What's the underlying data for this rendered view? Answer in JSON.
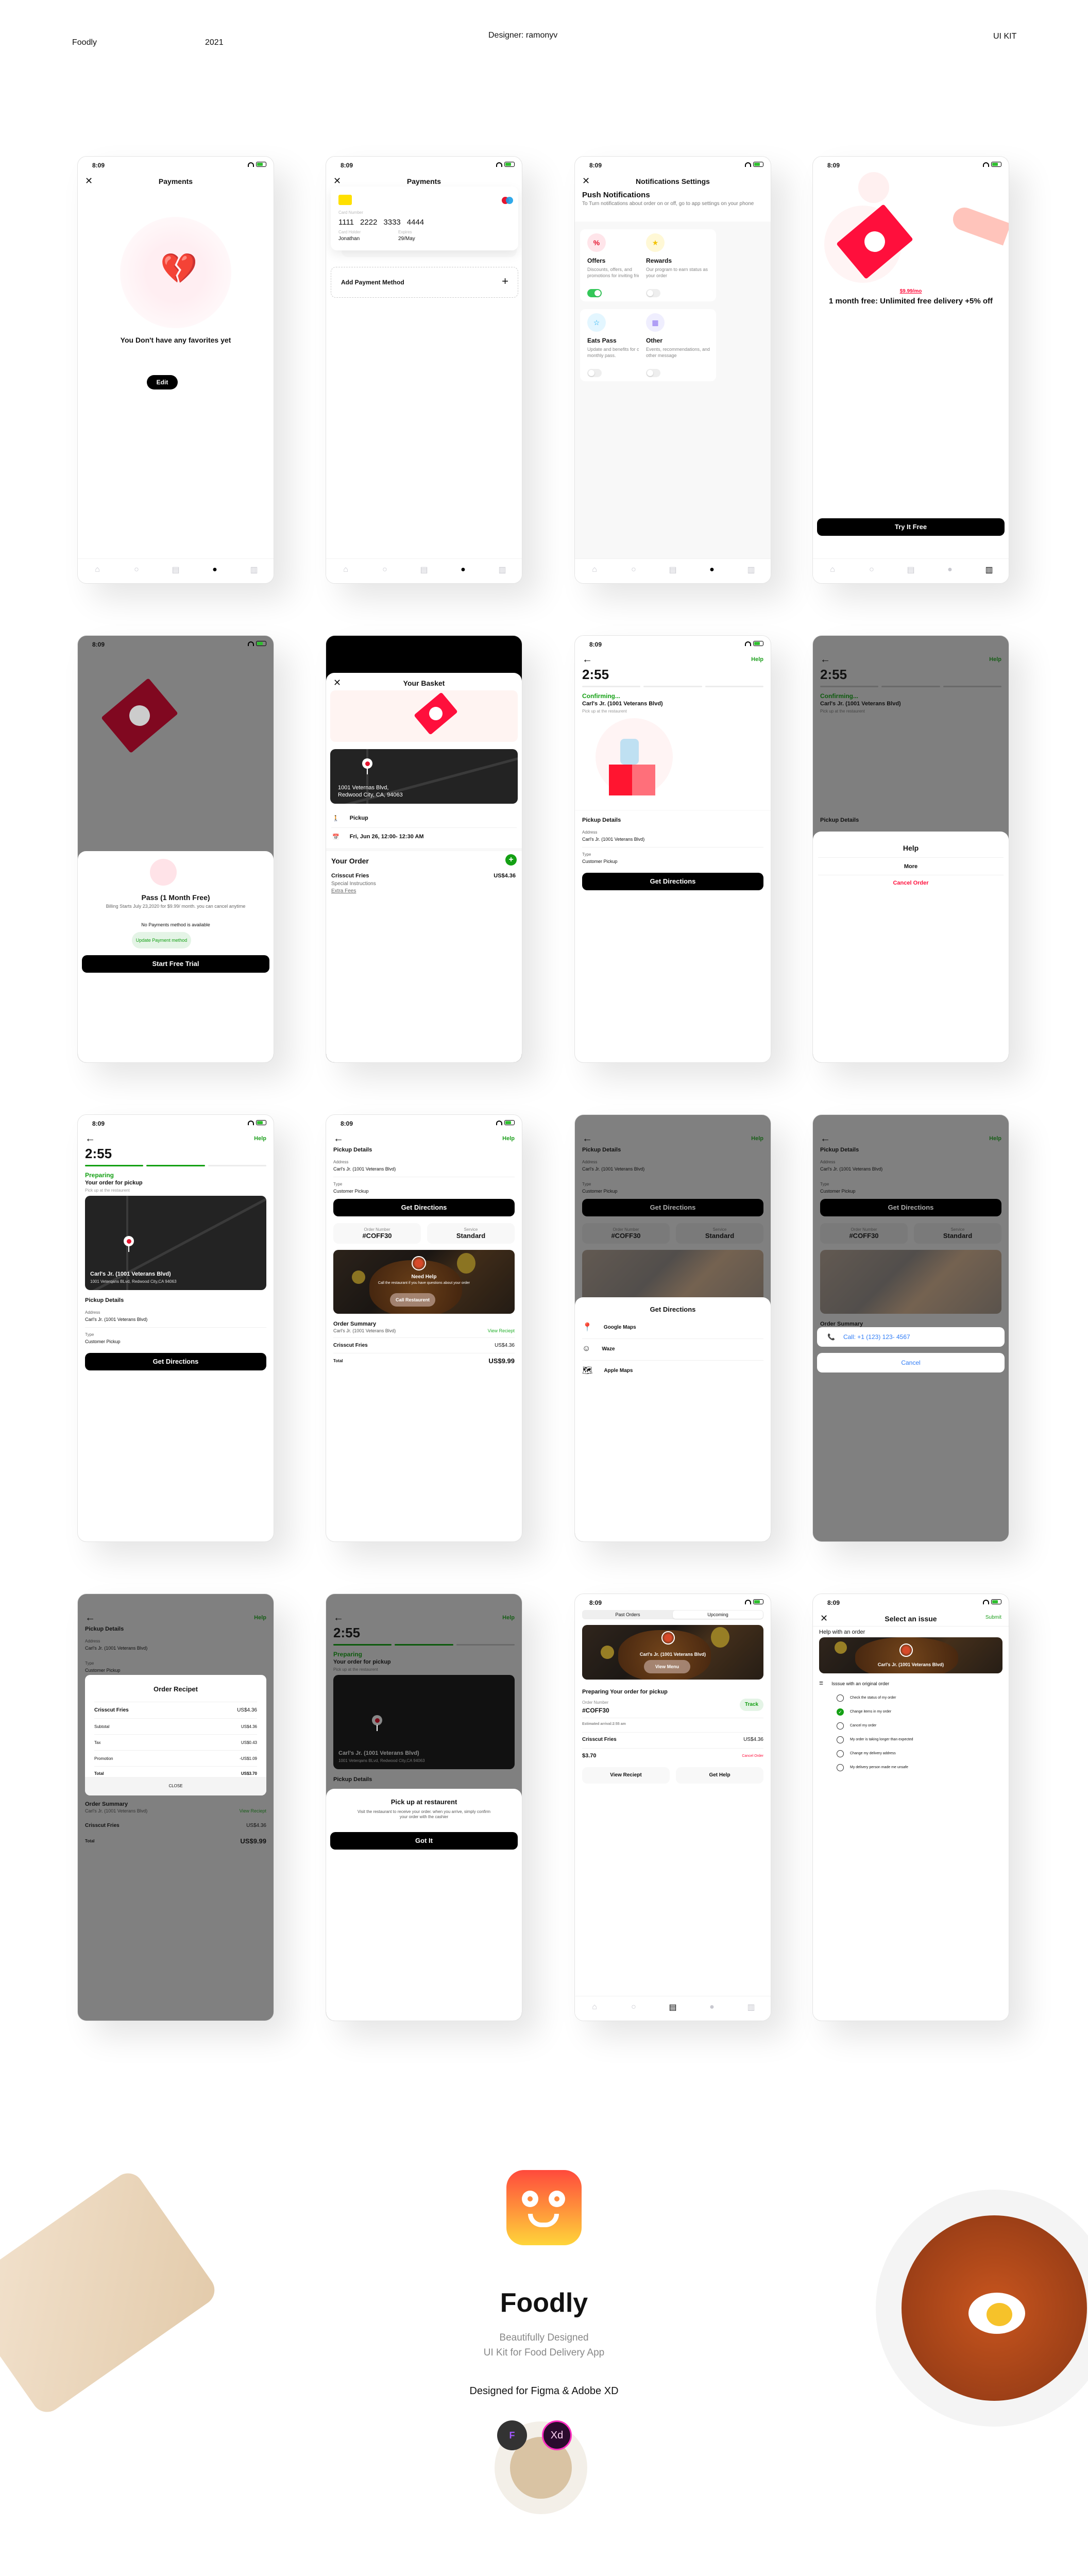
{
  "header": {
    "brand": "Foodly",
    "year": "2021",
    "designer": "Designer: ramonyv",
    "kit": "UI KIT"
  },
  "status_time": "8:09",
  "tabbar_icons": [
    "home-icon",
    "search-icon",
    "orders-icon",
    "profile-icon",
    "pass-icon"
  ],
  "screens": {
    "payments_empty": {
      "title": "Payments",
      "message": "You Don't have any favorites yet",
      "edit_label": "Edit"
    },
    "payments_card": {
      "title": "Payments",
      "card_number_label": "Card Number",
      "card_number": [
        "1111",
        "2222",
        "3333",
        "4444"
      ],
      "holder_label": "Card Holder",
      "holder": "Jonathan",
      "expires_label": "Expires",
      "expires": "29/May",
      "add_label": "Add Payment Method"
    },
    "notifications": {
      "title": "Notifications Settings",
      "heading": "Push Notifications",
      "description": "To Turn notifications about order on or off, go to app settings on your phone",
      "cards": [
        {
          "title": "Offers",
          "desc": "Discounts, offers, and promotions for inviting friends",
          "enabled": true,
          "color": "#ffe5ea",
          "icon": "%"
        },
        {
          "title": "Rewards",
          "desc": "Our program to earn status as your order",
          "enabled": false,
          "color": "#fff8d6",
          "icon": "★"
        },
        {
          "title": "Eats Pass",
          "desc": "Update and benefits for our monthly pass.",
          "enabled": false,
          "color": "#e3f6ff",
          "icon": "☆"
        },
        {
          "title": "Other",
          "desc": "Events, recommendations, and other message",
          "enabled": false,
          "color": "#efeefe",
          "icon": "▦"
        }
      ]
    },
    "pass_offer": {
      "price": "$9.99/mo",
      "headline": "1 month free: Unlimited free delivery +5% off",
      "cta": "Try It Free"
    },
    "pass_sheet": {
      "title": "Pass (1 Month Free)",
      "billing": "Billing Starts July 23,2020 for $9.99/ month. you can cancel anytime",
      "no_payment": "No Payments method is available",
      "update_label": "Update Payment method",
      "cta": "Start Free Trial"
    },
    "basket": {
      "title": "Your Basket",
      "address_line1": "1001 Veternas Blvd,",
      "address_line2": "Redwood City, CA, 94063",
      "pickup_label": "Pickup",
      "schedule": "Fri, Jun 26, 12:00- 12:30 AM",
      "your_order": "Your Order",
      "item_name": "Crisscut Fries",
      "item_price": "US$4.36",
      "special": "Special Instructions",
      "extra_fees": "Extra Fees"
    },
    "confirming": {
      "help": "Help",
      "timer": "2:55",
      "progress_steps_done": 0,
      "progress_steps_total": 3,
      "status": "Confirming...",
      "restaurant": "Carl's Jr. (1001 Veterans Blvd)",
      "sub": "Pick up at the restaurent",
      "pickup_details": "Pickup Details",
      "address_label": "Address",
      "address": "Carl's Jr. (1001 Veterans Blvd)",
      "type_label": "Type",
      "type": "Customer Pickup",
      "cta": "Get Directions"
    },
    "help_sheet": {
      "title": "Help",
      "more": "More",
      "cancel": "Cancel Order"
    },
    "preparing": {
      "help": "Help",
      "timer": "2:55",
      "progress_steps_done": 2,
      "progress_steps_total": 3,
      "status": "Preparing",
      "heading": "Your order for pickup",
      "sub": "Pick up at the restaurent",
      "map_title": "Carl's Jr. (1001 Veterans Blvd)",
      "map_address": "1001 Veterqans BLvd, Redwood City,CA 94063",
      "pickup_details": "Pickup Details",
      "address_label": "Address",
      "address": "Carl's Jr. (1001 Veterans Blvd)",
      "type_label": "Type",
      "type": "Customer Pickup",
      "cta": "Get Directions"
    },
    "order_details": {
      "help": "Help",
      "pickup_details": "Pickup Details",
      "address_label": "Address",
      "address": "Carl's Jr. (1001 Veterans Blvd)",
      "type_label": "Type",
      "type": "Customer Pickup",
      "cta": "Get Directions",
      "order_number_label": "Order Number",
      "order_number": "#COFF30",
      "service_label": "Service",
      "service": "Standard",
      "need_help": "Need Help",
      "need_help_desc": "Call the restaurant if you have questions about your order",
      "call_label": "Call Restaurent",
      "summary_title": "Order Summary",
      "summary_sub": "Carl's Jr. (1001 Veterans Blvd)",
      "view_receipt": "View Reciept",
      "item_name": "Crisscut Fries",
      "item_price": "US$4.36",
      "total_label": "Total",
      "total": "US$9.99"
    },
    "directions_sheet": {
      "title": "Get Directions",
      "options": [
        {
          "label": "Google Maps",
          "icon": "google-maps-icon"
        },
        {
          "label": "Waze",
          "icon": "waze-icon"
        },
        {
          "label": "Apple Maps",
          "icon": "apple-maps-icon"
        }
      ]
    },
    "call_sheet": {
      "call": "Call: +1 (123) 123- 4567",
      "cancel": "Cancel"
    },
    "receipt_modal": {
      "title": "Order Recipet",
      "rows": [
        {
          "label": "Crisscut Fries",
          "value": "US$4.36"
        },
        {
          "label": "Subtotal",
          "value": "US$4.36"
        },
        {
          "label": "Tax",
          "value": "US$0.43"
        },
        {
          "label": "Promotion",
          "value": "-US$1.09"
        },
        {
          "label": "Total",
          "value": "US$3.70"
        }
      ],
      "close": "CLOSE"
    },
    "pickup_sheet": {
      "title": "Pick up at restaurent",
      "desc": "Visit the restaurant to receive your order. when you arrive, simply confirm your order with the cashier",
      "cta": "Got It"
    },
    "orders": {
      "tabs": [
        "Past Orders",
        "Upcoming"
      ],
      "active_tab": "Upcoming",
      "restaurant": "Carl's Jr. (1001 Veterans Blvd)",
      "view_menu": "View Menu",
      "heading": "Preparing Your order for pickup",
      "order_number_label": "Order Number",
      "order_number": "#COFF30",
      "track": "Track",
      "eta": "Estimated arrival:2:55 am",
      "item_name": "Crisscut Fries",
      "item_price": "US$4.36",
      "total": "$3.70",
      "cancel": "Cancel Order",
      "view_receipt": "View Reciept",
      "get_help": "Get Help"
    },
    "select_issue": {
      "title": "Select an issue",
      "submit": "Submit",
      "help_heading": "Help with an order",
      "restaurant": "Carl's Jr. (1001 Veterans Blvd)",
      "group": "Isssue with an original order",
      "options": [
        {
          "label": "Check the status of my order",
          "selected": false
        },
        {
          "label": "Change items in my order",
          "selected": true
        },
        {
          "label": "Cancel my order",
          "selected": false
        },
        {
          "label": "My order is taking longer than expected",
          "selected": false
        },
        {
          "label": "Change my delivery address",
          "selected": false
        },
        {
          "label": "My delivery person made me unsafe",
          "selected": false
        }
      ]
    }
  },
  "promo": {
    "app_name": "Foodly",
    "tagline_1": "Beautifully Designed",
    "tagline_2": "UI Kit for Food  Delivery App",
    "designed_for": "Designed for Figma & Adobe XD",
    "tools": [
      "Figma",
      "Xd"
    ]
  },
  "colors": {
    "accent_green": "#14a014",
    "brand_red": "#ff0f3c",
    "link_blue": "#2f7cf6"
  }
}
